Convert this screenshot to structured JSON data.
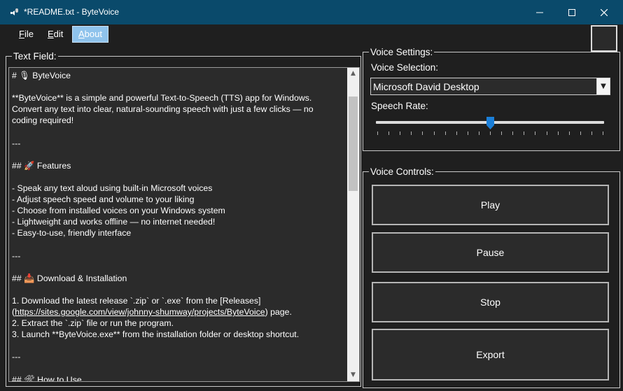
{
  "window": {
    "title": "*README.txt - ByteVoice",
    "icons": {
      "app": "bytevoice-app-icon",
      "minimize": "minimize-icon",
      "maximize": "maximize-icon",
      "close": "close-icon"
    }
  },
  "menu": {
    "items": [
      {
        "label": "File",
        "mnemonic": "F",
        "rest": "ile"
      },
      {
        "label": "Edit",
        "mnemonic": "E",
        "rest": "dit"
      },
      {
        "label": "About",
        "mnemonic": "A",
        "rest": "bout"
      }
    ]
  },
  "text_field": {
    "legend": "Text Field:",
    "lines": [
      "# 🎙 ByteVoice",
      "",
      "**ByteVoice** is a simple and powerful Text-to-Speech (TTS) app for Windows.",
      "Convert any text into clear, natural-sounding speech with just a few clicks — no",
      "coding required!",
      "",
      "---",
      "",
      "## 🚀 Features",
      "",
      "- Speak any text aloud using built-in Microsoft voices",
      "- Adjust speech speed and volume to your liking",
      "- Choose from installed voices on your Windows system",
      "- Lightweight and works offline — no internet needed!",
      "- Easy-to-use, friendly interface",
      "",
      "---",
      "",
      "## 📥 Download & Installation",
      "",
      "1. Download the latest release `.zip` or `.exe` from the [Releases]",
      "(https://sites.google.com/view/johnny-shumway/projects/ByteVoice) page.",
      "2. Extract the `.zip` file or run the program.",
      "3. Launch **ByteVoice.exe** from the installation folder or desktop shortcut.",
      "",
      "---",
      "",
      "## 🛠 How to Use"
    ],
    "link_text": "https://sites.google.com/view/johnny-shumway/projects/ByteVoice"
  },
  "voice_settings": {
    "legend": "Voice Settings:",
    "selection_label": "Voice Selection:",
    "selected_voice": "Microsoft David Desktop",
    "rate_label": "Speech Rate:",
    "rate_fraction": 0.5
  },
  "voice_controls": {
    "legend": "Voice Controls:",
    "buttons": {
      "play": "Play",
      "pause": "Pause",
      "stop": "Stop",
      "export": "Export"
    }
  }
}
